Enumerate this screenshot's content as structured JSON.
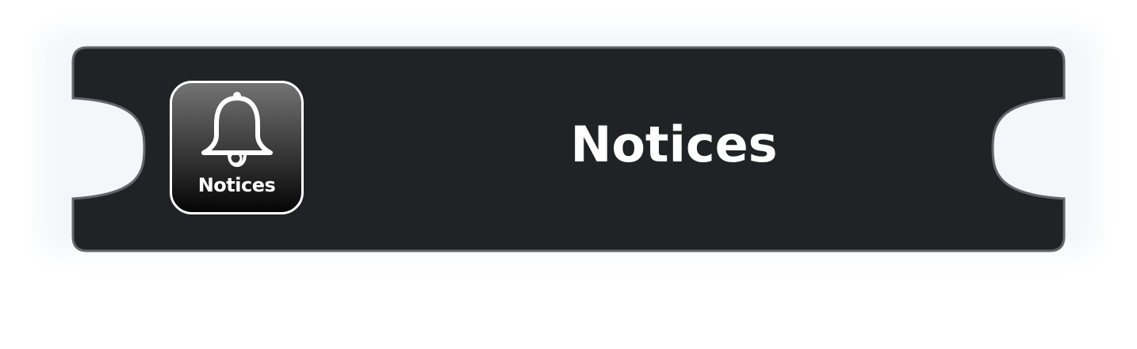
{
  "card": {
    "title": "Notices",
    "icon": {
      "name": "bell-icon",
      "label": "Notices"
    }
  },
  "colors": {
    "card_background": "#202226",
    "card_border": "#64666b",
    "text": "#ffffff",
    "icon_gradient_top": "#737373",
    "icon_gradient_bottom": "#050505"
  }
}
